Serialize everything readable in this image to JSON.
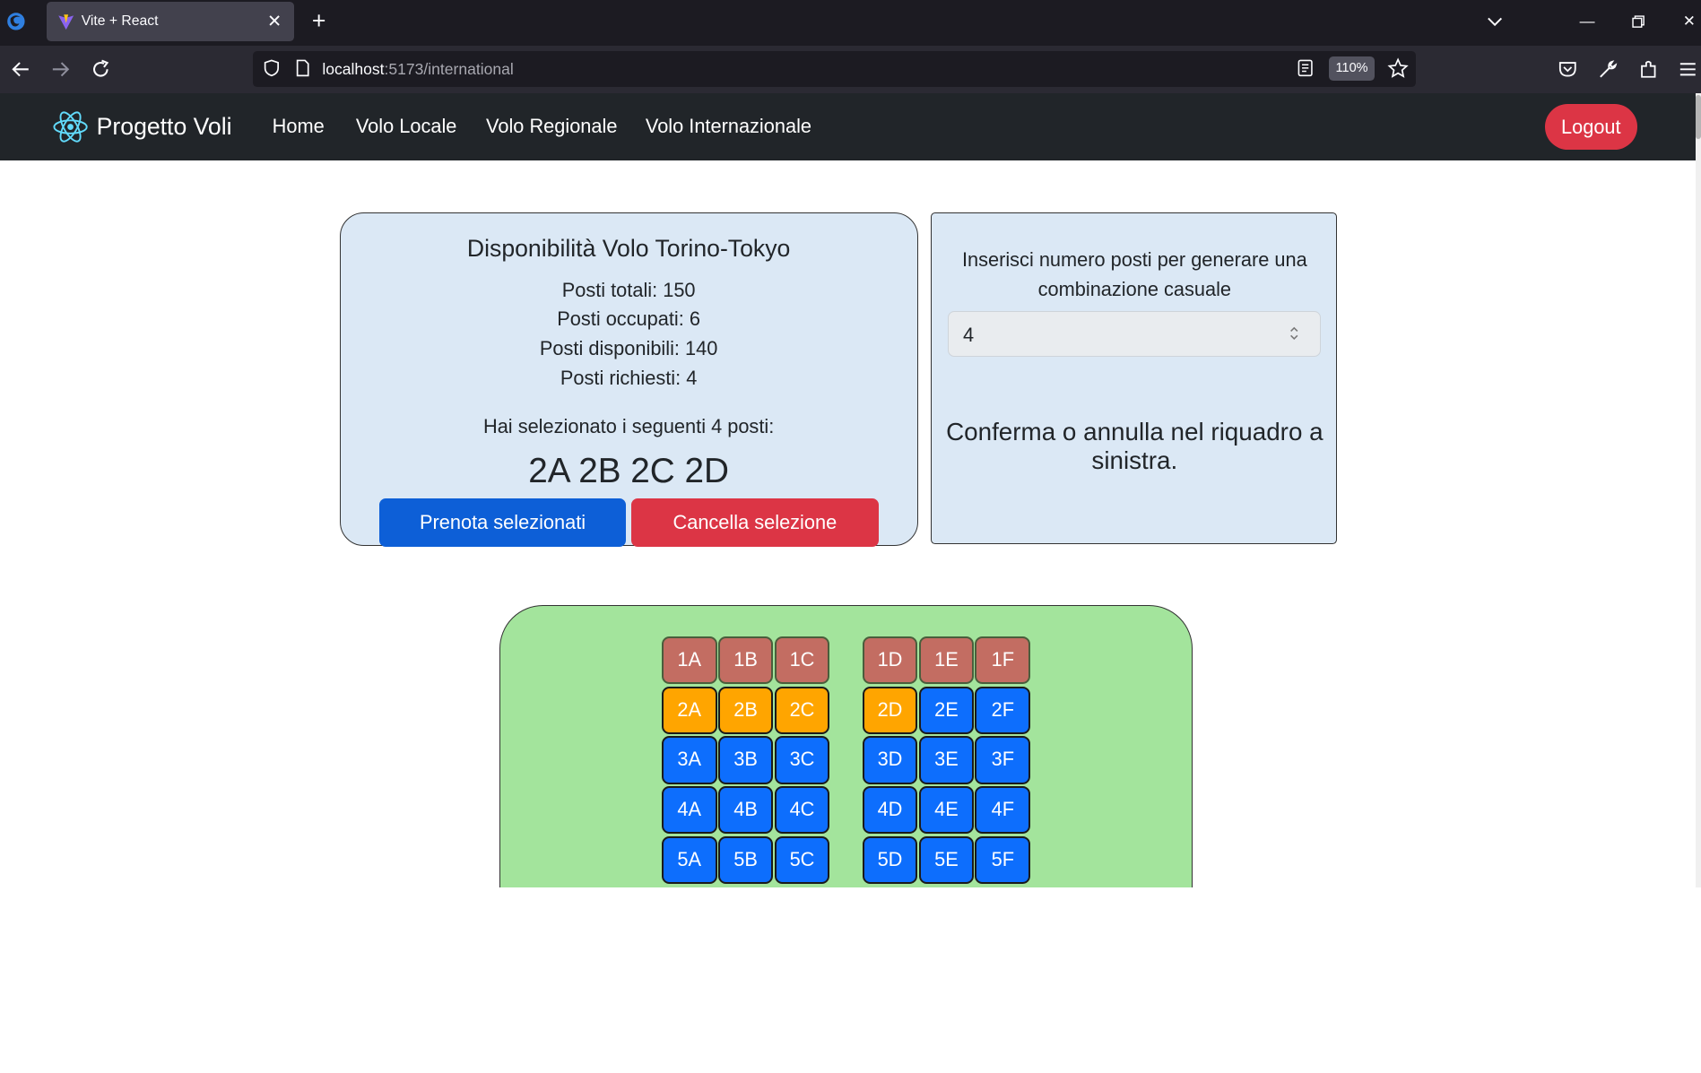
{
  "browser": {
    "tab_title": "Vite + React",
    "url_host": "localhost",
    "url_path": ":5173/international",
    "zoom": "110%",
    "colors": {
      "tabbar": "#1c1b22",
      "toolbar": "#2b2a33"
    }
  },
  "app": {
    "brand": "Progetto Voli",
    "nav": [
      "Home",
      "Volo Locale",
      "Volo Regionale",
      "Volo Internazionale"
    ],
    "logout": "Logout"
  },
  "info": {
    "title": "Disponibilità Volo Torino-Tokyo",
    "stats": [
      "Posti totali: 150",
      "Posti occupati: 6",
      "Posti disponibili: 140",
      "Posti richiesti: 4"
    ],
    "selection_label": "Hai selezionato i seguenti 4 posti:",
    "selected_seats": "2A 2B 2C 2D",
    "book_button": "Prenota selezionati",
    "cancel_button": "Cancella selezione"
  },
  "random": {
    "prompt": "Inserisci numero posti per generare una combinazione casuale",
    "value": "4",
    "confirm": "Conferma o annulla nel riquadro a sinistra."
  },
  "seats": {
    "colors": {
      "occupied": "#c36d62",
      "selected": "#ffa500",
      "free": "#0d6efd",
      "map_bg": "#a3e49c"
    },
    "rows": [
      [
        {
          "label": "1A",
          "status": "occupied"
        },
        {
          "label": "1B",
          "status": "occupied"
        },
        {
          "label": "1C",
          "status": "occupied"
        },
        {
          "label": "1D",
          "status": "occupied"
        },
        {
          "label": "1E",
          "status": "occupied"
        },
        {
          "label": "1F",
          "status": "occupied"
        }
      ],
      [
        {
          "label": "2A",
          "status": "selected"
        },
        {
          "label": "2B",
          "status": "selected"
        },
        {
          "label": "2C",
          "status": "selected"
        },
        {
          "label": "2D",
          "status": "selected"
        },
        {
          "label": "2E",
          "status": "free"
        },
        {
          "label": "2F",
          "status": "free"
        }
      ],
      [
        {
          "label": "3A",
          "status": "free"
        },
        {
          "label": "3B",
          "status": "free"
        },
        {
          "label": "3C",
          "status": "free"
        },
        {
          "label": "3D",
          "status": "free"
        },
        {
          "label": "3E",
          "status": "free"
        },
        {
          "label": "3F",
          "status": "free"
        }
      ],
      [
        {
          "label": "4A",
          "status": "free"
        },
        {
          "label": "4B",
          "status": "free"
        },
        {
          "label": "4C",
          "status": "free"
        },
        {
          "label": "4D",
          "status": "free"
        },
        {
          "label": "4E",
          "status": "free"
        },
        {
          "label": "4F",
          "status": "free"
        }
      ],
      [
        {
          "label": "5A",
          "status": "free"
        },
        {
          "label": "5B",
          "status": "free"
        },
        {
          "label": "5C",
          "status": "free"
        },
        {
          "label": "5D",
          "status": "free"
        },
        {
          "label": "5E",
          "status": "free"
        },
        {
          "label": "5F",
          "status": "free"
        }
      ]
    ]
  }
}
